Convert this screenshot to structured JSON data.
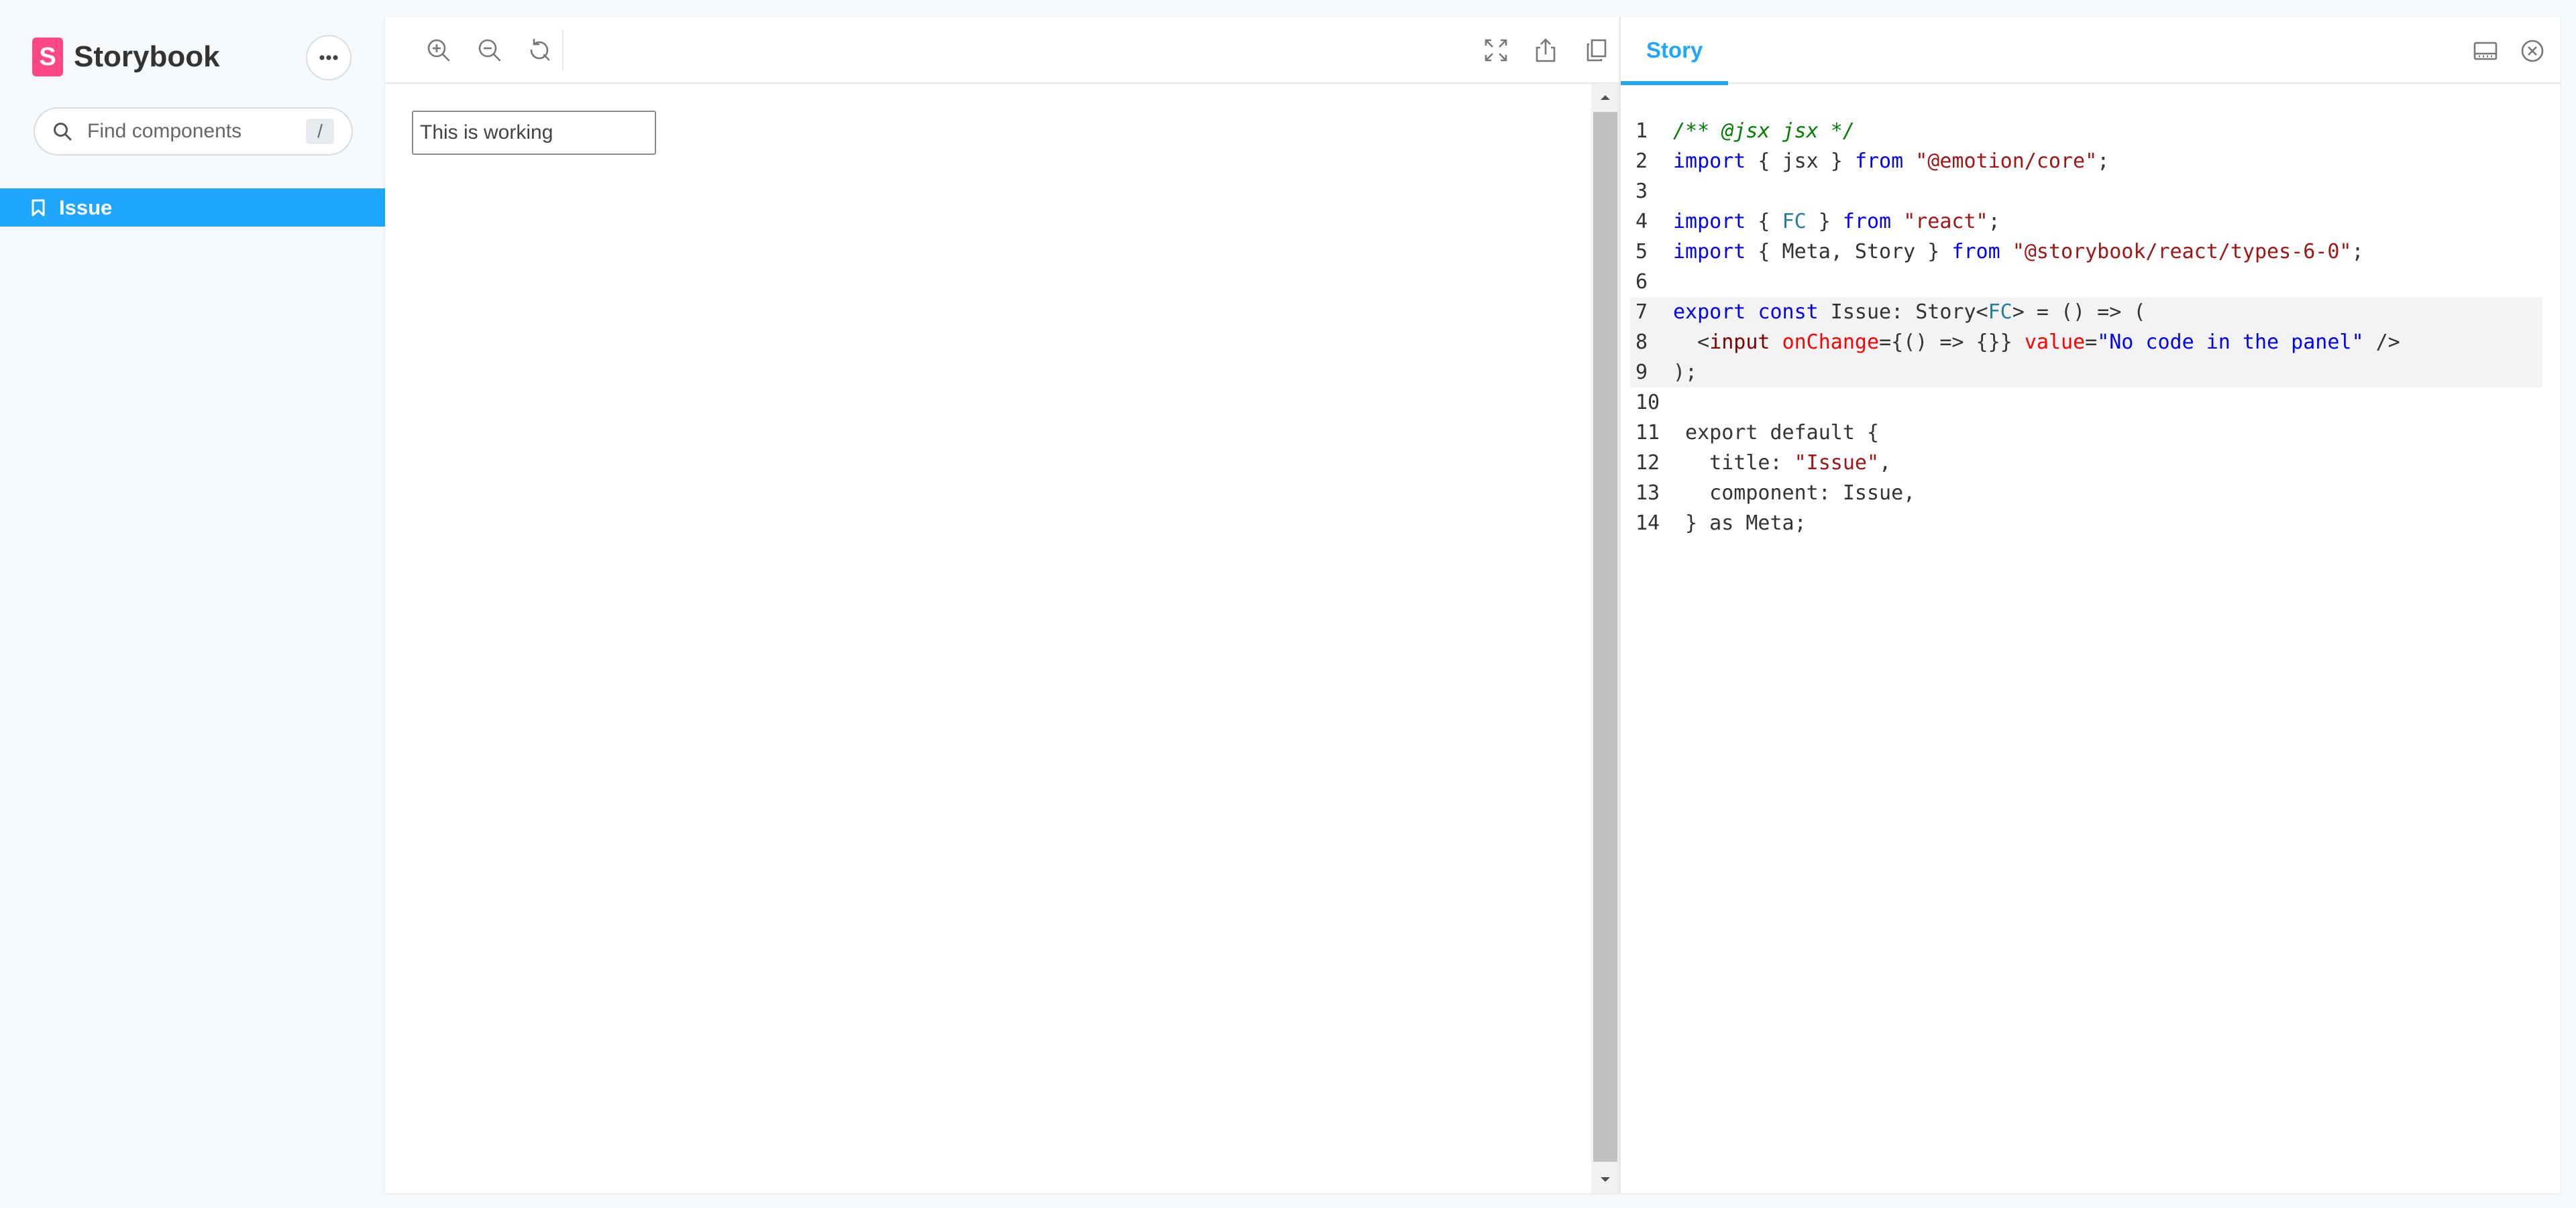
{
  "app": {
    "name": "Storybook",
    "logo_letter": "S"
  },
  "sidebar": {
    "search": {
      "placeholder": "Find components",
      "shortcut": "/"
    },
    "items": [
      {
        "label": "Issue",
        "selected": true
      }
    ]
  },
  "toolbar": {
    "icons": [
      "zoom-in-icon",
      "zoom-out-icon",
      "reset-zoom-icon",
      "fullscreen-icon",
      "share-icon",
      "copy-link-icon"
    ]
  },
  "preview": {
    "input_value": "This is working"
  },
  "addon": {
    "active_tab": "Story",
    "icons": [
      "panel-orientation-icon",
      "close-icon"
    ]
  },
  "code": {
    "lines": [
      {
        "n": "1",
        "hl": false,
        "tokens": [
          {
            "t": "/** @jsx jsx */",
            "c": "comment"
          }
        ]
      },
      {
        "n": "2",
        "hl": false,
        "tokens": [
          {
            "t": "import",
            "c": "kw"
          },
          {
            "t": " { jsx } ",
            "c": "plain"
          },
          {
            "t": "from",
            "c": "kw"
          },
          {
            "t": " ",
            "c": "plain"
          },
          {
            "t": "\"@emotion/core\"",
            "c": "str"
          },
          {
            "t": ";",
            "c": "plain"
          }
        ]
      },
      {
        "n": "3",
        "hl": false,
        "tokens": []
      },
      {
        "n": "4",
        "hl": false,
        "tokens": [
          {
            "t": "import",
            "c": "kw"
          },
          {
            "t": " { ",
            "c": "plain"
          },
          {
            "t": "FC",
            "c": "type"
          },
          {
            "t": " } ",
            "c": "plain"
          },
          {
            "t": "from",
            "c": "kw"
          },
          {
            "t": " ",
            "c": "plain"
          },
          {
            "t": "\"react\"",
            "c": "str"
          },
          {
            "t": ";",
            "c": "plain"
          }
        ]
      },
      {
        "n": "5",
        "hl": false,
        "tokens": [
          {
            "t": "import",
            "c": "kw"
          },
          {
            "t": " { Meta, Story } ",
            "c": "plain"
          },
          {
            "t": "from",
            "c": "kw"
          },
          {
            "t": " ",
            "c": "plain"
          },
          {
            "t": "\"@storybook/react/types-6-0\"",
            "c": "str"
          },
          {
            "t": ";",
            "c": "plain"
          }
        ]
      },
      {
        "n": "6",
        "hl": false,
        "tokens": []
      },
      {
        "n": "7",
        "hl": true,
        "tokens": [
          {
            "t": "export",
            "c": "kw"
          },
          {
            "t": " ",
            "c": "plain"
          },
          {
            "t": "const",
            "c": "kw"
          },
          {
            "t": " Issue: Story<",
            "c": "plain"
          },
          {
            "t": "FC",
            "c": "type"
          },
          {
            "t": "> = () => (",
            "c": "plain"
          }
        ]
      },
      {
        "n": "8",
        "hl": true,
        "tokens": [
          {
            "t": "  <",
            "c": "plain"
          },
          {
            "t": "input",
            "c": "tag"
          },
          {
            "t": " ",
            "c": "plain"
          },
          {
            "t": "onChange",
            "c": "attr"
          },
          {
            "t": "={() => {}} ",
            "c": "plain"
          },
          {
            "t": "value",
            "c": "attr"
          },
          {
            "t": "=",
            "c": "plain"
          },
          {
            "t": "\"No code in the panel\"",
            "c": "attrval"
          },
          {
            "t": " />",
            "c": "plain"
          }
        ]
      },
      {
        "n": "9",
        "hl": true,
        "tokens": [
          {
            "t": ");",
            "c": "plain"
          }
        ]
      },
      {
        "n": "10",
        "hl": false,
        "tokens": []
      },
      {
        "n": "11",
        "hl": false,
        "tokens": [
          {
            "t": " export default {",
            "c": "plain"
          }
        ]
      },
      {
        "n": "12",
        "hl": false,
        "tokens": [
          {
            "t": "   title: ",
            "c": "plain"
          },
          {
            "t": "\"Issue\"",
            "c": "str"
          },
          {
            "t": ",",
            "c": "plain"
          }
        ]
      },
      {
        "n": "13",
        "hl": false,
        "tokens": [
          {
            "t": "   component: Issue,",
            "c": "plain"
          }
        ]
      },
      {
        "n": "14",
        "hl": false,
        "tokens": [
          {
            "t": " } as Meta;",
            "c": "plain"
          }
        ]
      }
    ]
  }
}
